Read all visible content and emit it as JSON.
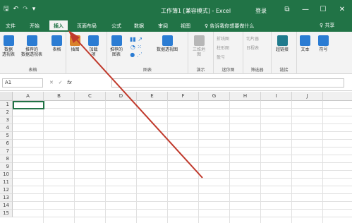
{
  "window": {
    "title": "工作簿1 [兼容模式] - Excel",
    "login": "登录",
    "restore": "⧉",
    "minimize": "—",
    "maximize": "☐",
    "close": "✕"
  },
  "qat": {
    "save": "🖫",
    "undo": "↶",
    "redo": "↷",
    "more": "▾"
  },
  "tabs": [
    "文件",
    "开始",
    "插入",
    "页面布局",
    "公式",
    "数据",
    "审阅",
    "视图"
  ],
  "active_tab": "插入",
  "tellme": "♀ 告诉我你想要做什么",
  "share": "♀ 共享",
  "ribbon": {
    "groups": {
      "tables": "表格",
      "charts": "图表",
      "tours": "演示",
      "sparklines": "迷你图",
      "filters": "筛选器",
      "links": "链接"
    },
    "buttons": {
      "pivot": "数据\n透视表",
      "recommended_pivot": "推荐的\n数据透视表",
      "table": "表格",
      "illustrations": "插图",
      "addins": "加载\n项",
      "recommended_charts": "推荐的\n图表",
      "pivot_chart": "数据透视图",
      "map3d": "三维地\n图",
      "hyperlink": "超链接",
      "text": "文本",
      "symbol": "符号"
    },
    "sparkline_items": [
      "折线图",
      "柱形图",
      "盈亏"
    ],
    "filter_items": [
      "切片器",
      "日程表"
    ]
  },
  "formula_bar": {
    "name_box": "A1",
    "fx": "fx",
    "cancel": "✕",
    "enter": "✓"
  },
  "grid": {
    "columns": [
      "A",
      "B",
      "C",
      "D",
      "E",
      "F",
      "G",
      "H",
      "I",
      "J"
    ],
    "rows": [
      "1",
      "2",
      "3",
      "4",
      "5",
      "6",
      "7",
      "8",
      "9",
      "10",
      "11",
      "12",
      "13",
      "14",
      "15"
    ]
  },
  "colors": {
    "accent": "#217346",
    "arrow": "#c0392b"
  }
}
